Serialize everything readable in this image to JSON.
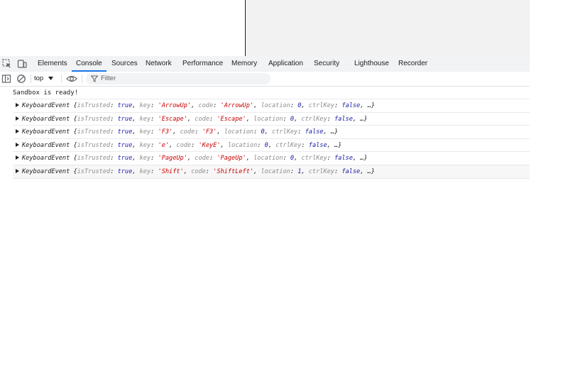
{
  "devtools": {
    "tabs": [
      "Elements",
      "Console",
      "Sources",
      "Network",
      "Performance",
      "Memory",
      "Application",
      "Security",
      "Lighthouse",
      "Recorder"
    ],
    "active_tab": "Console",
    "context": "top",
    "filter_placeholder": "Filter"
  },
  "console": {
    "log_message": "Sandbox is ready!",
    "events": [
      {
        "type": "KeyboardEvent",
        "isTrusted": "true",
        "key": "'ArrowUp'",
        "code": "'ArrowUp'",
        "location": "0",
        "ctrlKey": "false"
      },
      {
        "type": "KeyboardEvent",
        "isTrusted": "true",
        "key": "'Escape'",
        "code": "'Escape'",
        "location": "0",
        "ctrlKey": "false"
      },
      {
        "type": "KeyboardEvent",
        "isTrusted": "true",
        "key": "'F3'",
        "code": "'F3'",
        "location": "0",
        "ctrlKey": "false"
      },
      {
        "type": "KeyboardEvent",
        "isTrusted": "true",
        "key": "'e'",
        "code": "'KeyE'",
        "location": "0",
        "ctrlKey": "false"
      },
      {
        "type": "KeyboardEvent",
        "isTrusted": "true",
        "key": "'PageUp'",
        "code": "'PageUp'",
        "location": "0",
        "ctrlKey": "false"
      },
      {
        "type": "KeyboardEvent",
        "isTrusted": "true",
        "key": "'Shift'",
        "code": "'ShiftLeft'",
        "location": "1",
        "ctrlKey": "false"
      }
    ]
  }
}
